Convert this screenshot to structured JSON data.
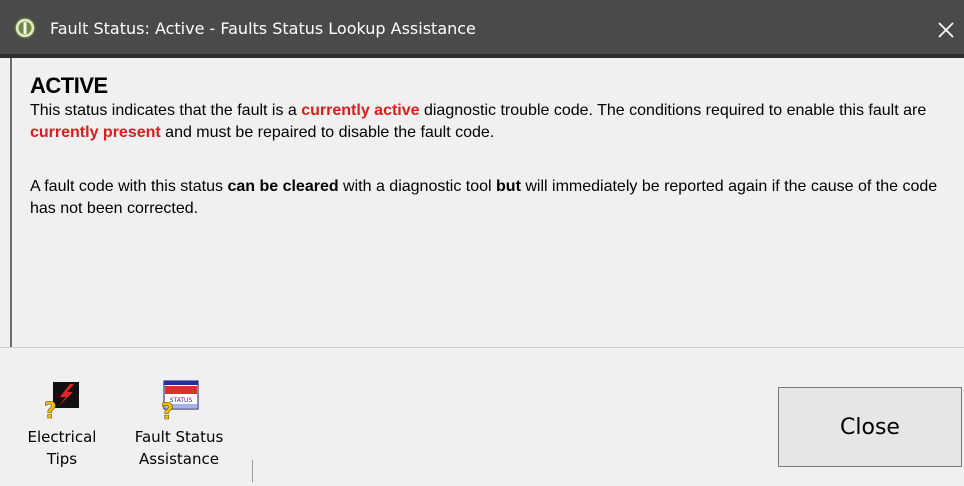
{
  "window": {
    "title": "Fault Status: Active - Faults Status Lookup Assistance"
  },
  "content": {
    "heading": "ACTIVE",
    "para1": {
      "a": "This status indicates that the fault is a ",
      "b": "currently active",
      "c": " diagnostic trouble code. The conditions required to enable this fault are ",
      "d": "currently present",
      "e": " and must be repaired to disable the fault code."
    },
    "para2": {
      "a": "A fault code with this status ",
      "b": "can be cleared",
      "c": " with a diagnostic tool ",
      "d": "but",
      "e": " will immediately be reported again if the cause of the code has not been corrected."
    }
  },
  "toolbar": {
    "electrical_tips": {
      "line1": "Electrical",
      "line2": "Tips",
      "icon": "electrical-tips-icon"
    },
    "fault_status_assistance": {
      "line1": "Fault Status",
      "line2": "Assistance",
      "icon": "fault-status-icon",
      "icon_text": "STATUS"
    }
  },
  "close_button": {
    "label": "Close"
  },
  "colors": {
    "titlebar": "#4a4a4a",
    "highlight_red": "#e01b1b",
    "background": "#f0f0f0"
  }
}
